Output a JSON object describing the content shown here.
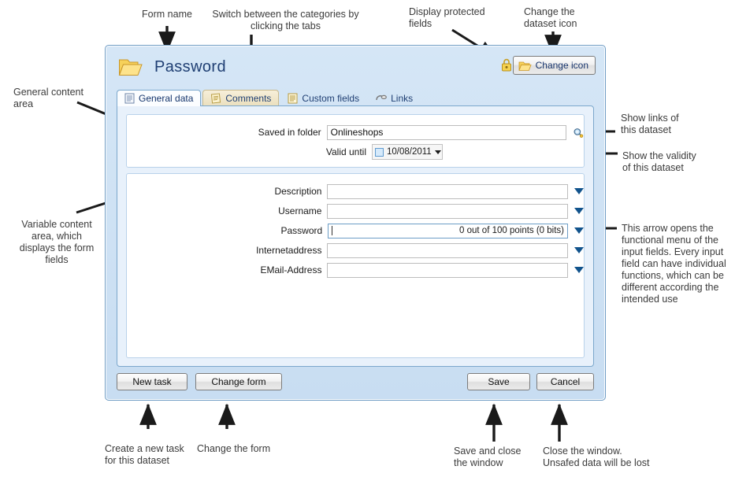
{
  "dialog": {
    "title": "Password",
    "folder_icon": "folder-icon",
    "lock_icon": "lock-icon",
    "change_icon_button": "Change icon",
    "tabs": [
      {
        "label": "General data",
        "icon": "document-icon",
        "active": true
      },
      {
        "label": "Comments",
        "icon": "notes-icon",
        "active": false
      },
      {
        "label": "Custom fields",
        "icon": "document-icon",
        "active": false
      },
      {
        "label": "Links",
        "icon": "link-icon",
        "active": false
      }
    ],
    "general_area": {
      "saved_in_folder": {
        "label": "Saved in folder",
        "value": "Onlineshops"
      },
      "valid_until": {
        "label": "Valid until",
        "value": "10/08/2011",
        "checked": false
      },
      "link_icon": "search-links-icon"
    },
    "variable_area": {
      "fields": [
        {
          "label": "Description",
          "value": ""
        },
        {
          "label": "Username",
          "value": ""
        },
        {
          "label": "Password",
          "value": "",
          "strength": "0 out of 100 points (0 bits)",
          "focused": true
        },
        {
          "label": "Internetaddress",
          "value": ""
        },
        {
          "label": "EMail-Address",
          "value": ""
        }
      ]
    },
    "footer": {
      "new_task": "New task",
      "change_form": "Change form",
      "save": "Save",
      "cancel": "Cancel"
    }
  },
  "annotations": {
    "form_name": "Form name",
    "switch_categories": "Switch between the categories by\nclicking the tabs",
    "display_protected": "Display protected\nfields",
    "change_dataset_icon": "Change the\ndataset icon",
    "general_content_area": "General content\narea",
    "variable_content_area": "Variable content\narea, which\ndisplays the form\nfields",
    "show_links": "Show links of\nthis dataset",
    "show_validity": "Show the validity\nof this dataset",
    "arrow_menu": "This arrow opens the\nfunctional menu of the\ninput fields. Every input\nfield can have individual\nfunctions, which can be\ndifferent according the\nintended use",
    "create_new_task": "Create a new task\nfor this dataset",
    "change_the_form": "Change the form",
    "save_and_close": "Save and close\nthe window",
    "close_window": "Close the window.\nUnsafed data will be lost"
  },
  "colors": {
    "dialog_bg": "#cfe2f4",
    "dialog_border": "#6e9cc4",
    "panel_bg": "#e8f1fb",
    "title_text": "#1f3f73",
    "dropdown_arrow": "#11538c",
    "annotation_text": "#3b3b3b"
  }
}
